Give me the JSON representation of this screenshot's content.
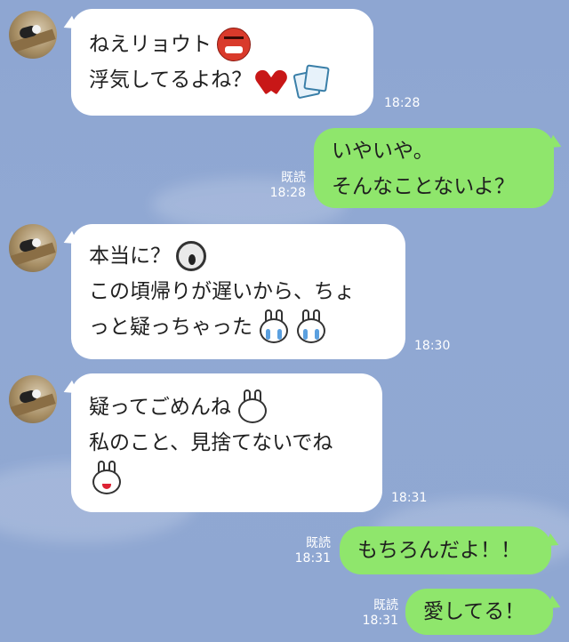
{
  "messages": [
    {
      "lines": [
        "ねえリョウト",
        "浮気してるよね？"
      ],
      "time": "18:28",
      "icons": [
        "angry-face-icon",
        "broken-heart-icon",
        "photos-icon"
      ]
    },
    {
      "lines": [
        "いやいや。",
        "そんなことないよ？"
      ],
      "read_label": "既読",
      "time": "18:28"
    },
    {
      "lines": [
        "本当に？",
        "この頃帰りが遅いから、ちょ",
        "っと疑っちゃった"
      ],
      "time": "18:30",
      "icons": [
        "scream-face-icon",
        "crying-bunny-icon",
        "crying-bunny-icon"
      ]
    },
    {
      "lines": [
        "疑ってごめんね",
        "私のこと、見捨てないでね"
      ],
      "time": "18:31",
      "icons": [
        "sad-bunny-icon",
        "happy-bunny-icon"
      ]
    },
    {
      "lines": [
        "もちろんだよ！！"
      ],
      "read_label": "既読",
      "time": "18:31"
    },
    {
      "lines": [
        "愛してる！"
      ],
      "read_label": "既読",
      "time": "18:31"
    }
  ],
  "colors": {
    "background": "#8fa7d2",
    "incoming_bubble": "#ffffff",
    "outgoing_bubble": "#8fe66c"
  }
}
